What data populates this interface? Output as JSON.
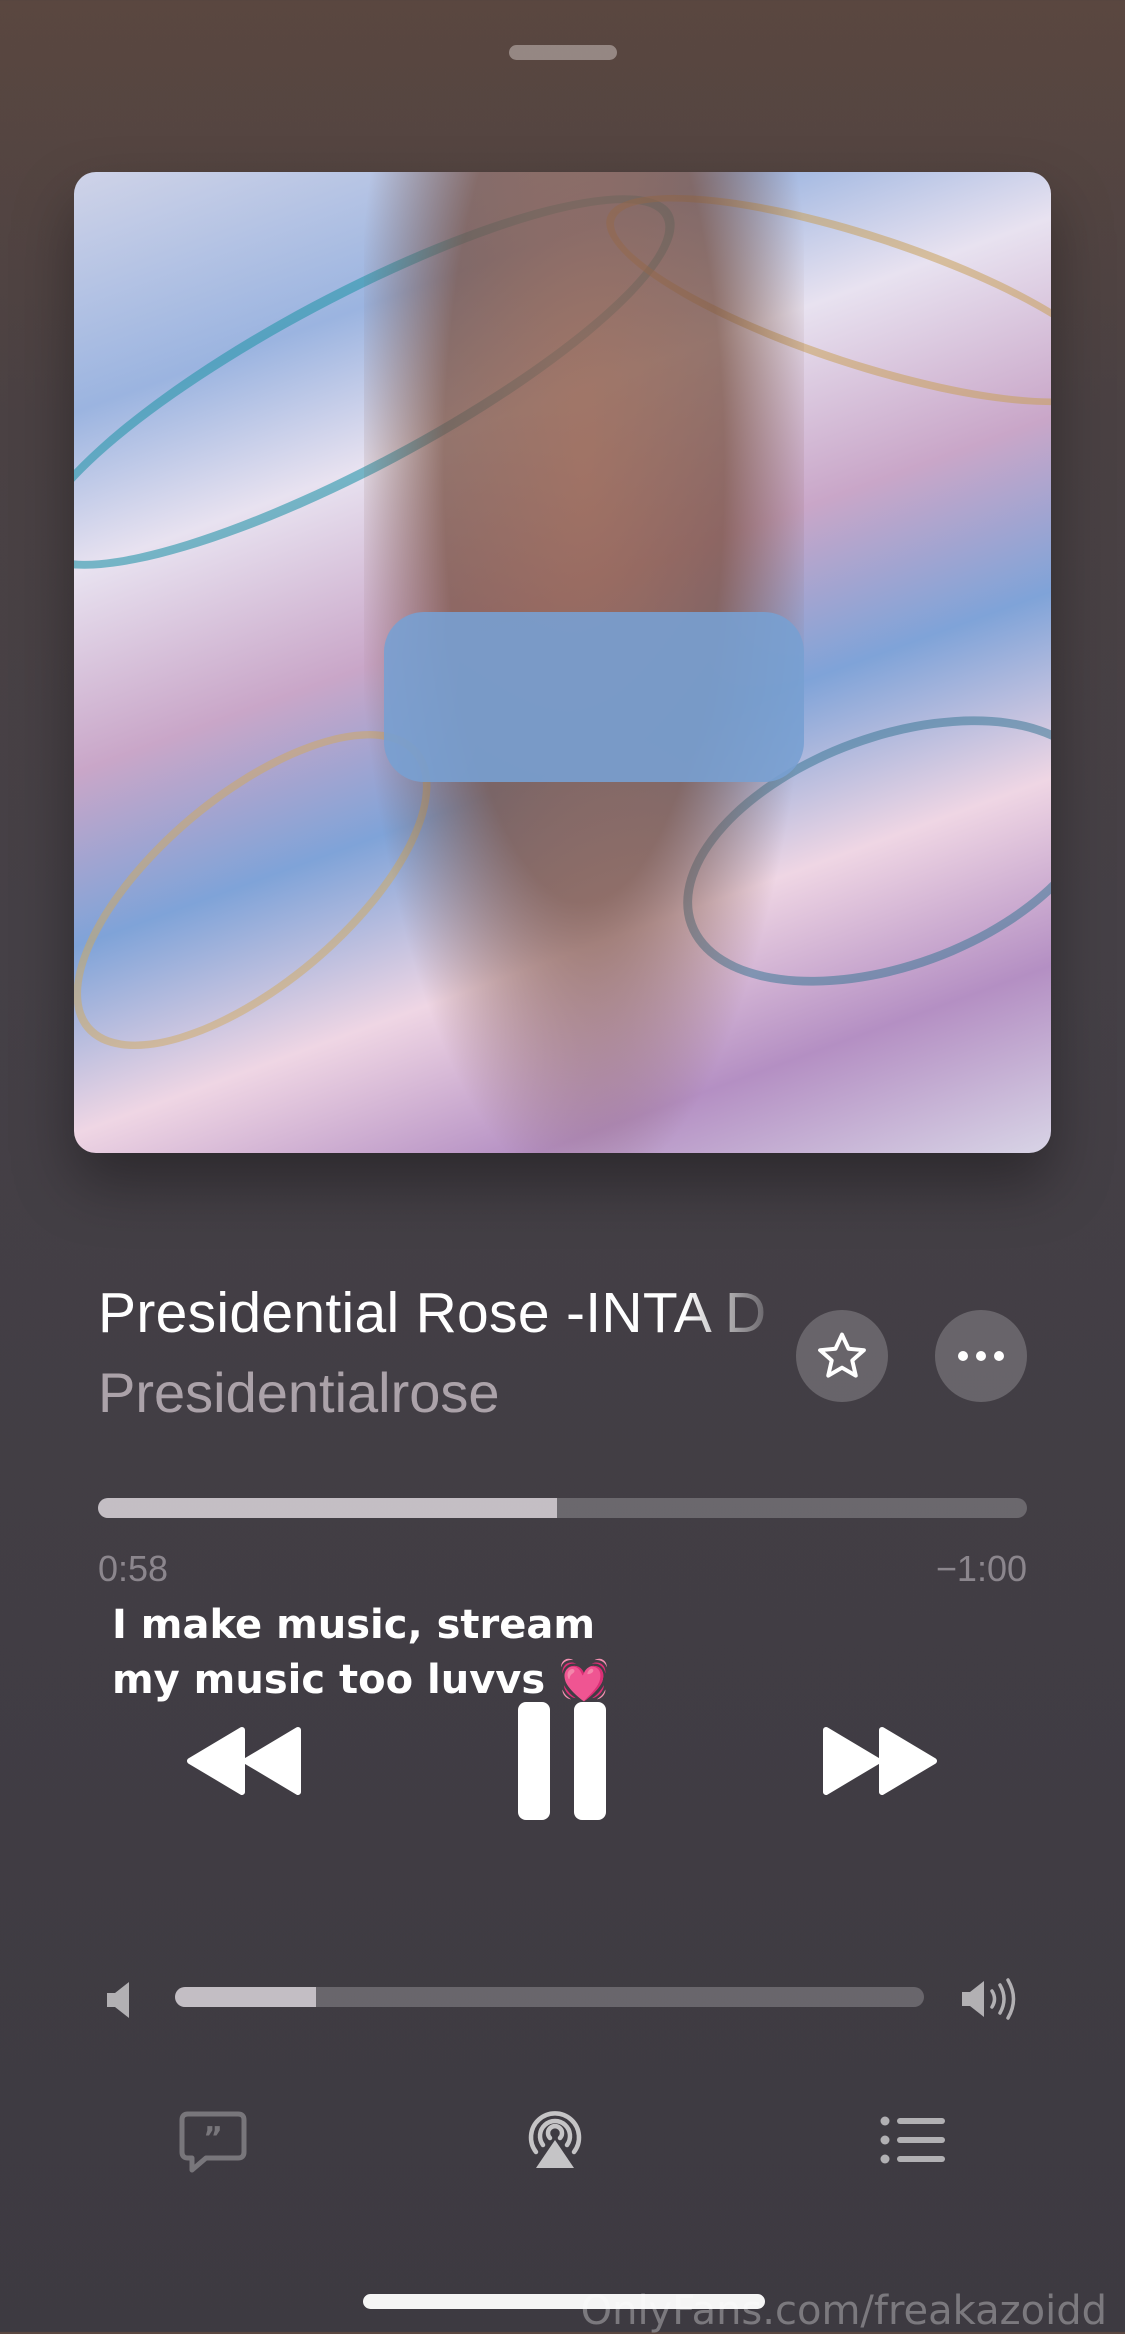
{
  "track": {
    "title": "Presidential Rose -INTA D",
    "artist": "Presidentialrose"
  },
  "playback": {
    "elapsed": "0:58",
    "remaining": "−1:00",
    "progress_fraction": 0.494
  },
  "caption": {
    "line1": "I make music, stream",
    "line2": "my music too luvvs 💓"
  },
  "volume": {
    "level_fraction": 0.188
  },
  "icons": {
    "favorite": "star-icon",
    "more": "ellipsis-icon",
    "rewind": "rewind-icon",
    "pause": "pause-icon",
    "forward": "forward-icon",
    "volume_low": "speaker-low-icon",
    "volume_high": "speaker-high-icon",
    "lyrics": "lyrics-quote-icon",
    "airplay": "airplay-icon",
    "queue": "queue-list-icon"
  },
  "watermark": "OnlyFans.com/freakazoidd"
}
